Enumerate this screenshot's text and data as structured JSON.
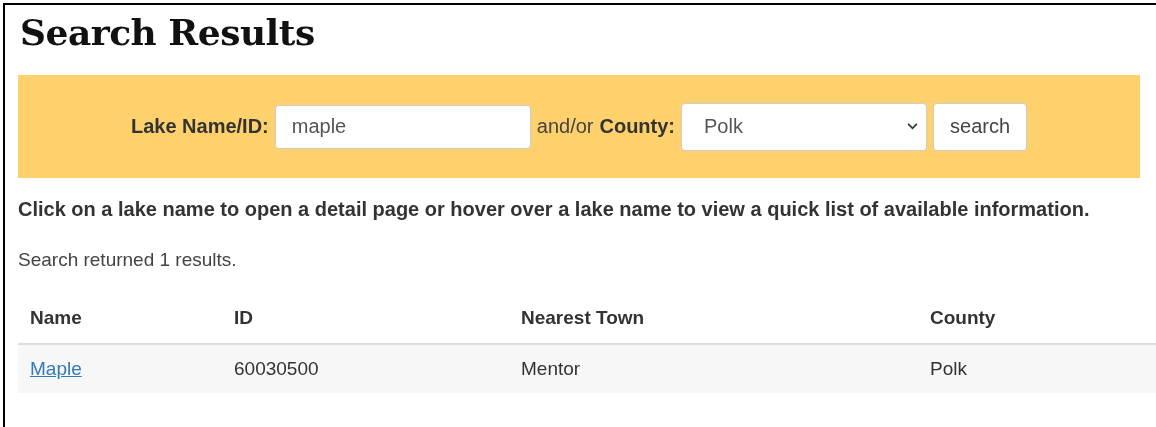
{
  "title": "Search Results",
  "search": {
    "name_label": "Lake Name/ID:",
    "name_value": "maple",
    "connector": "and/or",
    "county_label": "County:",
    "county_value": "Polk",
    "button": "search"
  },
  "instructions": "Click on a lake name to open a detail page or hover over a lake name to view a quick list of available information.",
  "result_count": "Search returned 1 results.",
  "table": {
    "columns": [
      "Name",
      "ID",
      "Nearest Town",
      "County"
    ],
    "rows": [
      {
        "name": "Maple",
        "id": "60030500",
        "nearest_town": "Mentor",
        "county": "Polk"
      }
    ]
  }
}
